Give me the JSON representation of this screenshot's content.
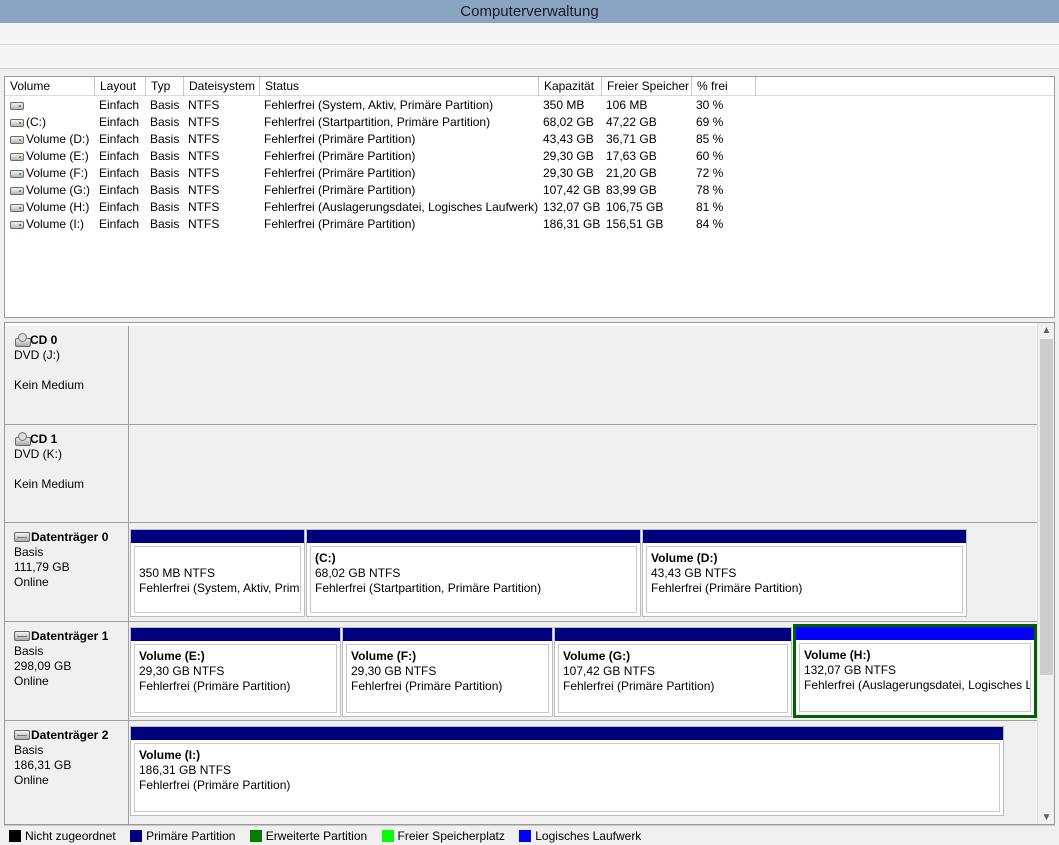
{
  "window": {
    "title": "Computerverwaltung"
  },
  "volume_list": {
    "columns": [
      "Volume",
      "Layout",
      "Typ",
      "Dateisystem",
      "Status",
      "Kapazität",
      "Freier Speicher",
      "% frei"
    ],
    "rows": [
      {
        "volume": "",
        "layout": "Einfach",
        "typ": "Basis",
        "fs": "NTFS",
        "status": "Fehlerfrei (System, Aktiv, Primäre Partition)",
        "kapazitaet": "350 MB",
        "frei": "106 MB",
        "pct": "30 %"
      },
      {
        "volume": "(C:)",
        "layout": "Einfach",
        "typ": "Basis",
        "fs": "NTFS",
        "status": "Fehlerfrei (Startpartition, Primäre Partition)",
        "kapazitaet": "68,02 GB",
        "frei": "47,22 GB",
        "pct": "69 %"
      },
      {
        "volume": "Volume (D:)",
        "layout": "Einfach",
        "typ": "Basis",
        "fs": "NTFS",
        "status": "Fehlerfrei (Primäre Partition)",
        "kapazitaet": "43,43 GB",
        "frei": "36,71 GB",
        "pct": "85 %"
      },
      {
        "volume": "Volume (E:)",
        "layout": "Einfach",
        "typ": "Basis",
        "fs": "NTFS",
        "status": "Fehlerfrei (Primäre Partition)",
        "kapazitaet": "29,30 GB",
        "frei": "17,63 GB",
        "pct": "60 %"
      },
      {
        "volume": "Volume (F:)",
        "layout": "Einfach",
        "typ": "Basis",
        "fs": "NTFS",
        "status": "Fehlerfrei (Primäre Partition)",
        "kapazitaet": "29,30 GB",
        "frei": "21,20 GB",
        "pct": "72 %"
      },
      {
        "volume": "Volume (G:)",
        "layout": "Einfach",
        "typ": "Basis",
        "fs": "NTFS",
        "status": "Fehlerfrei (Primäre Partition)",
        "kapazitaet": "107,42 GB",
        "frei": "83,99 GB",
        "pct": "78 %"
      },
      {
        "volume": "Volume (H:)",
        "layout": "Einfach",
        "typ": "Basis",
        "fs": "NTFS",
        "status": "Fehlerfrei (Auslagerungsdatei, Logisches Laufwerk)",
        "kapazitaet": "132,07 GB",
        "frei": "106,75 GB",
        "pct": "81 %"
      },
      {
        "volume": "Volume (I:)",
        "layout": "Einfach",
        "typ": "Basis",
        "fs": "NTFS",
        "status": "Fehlerfrei (Primäre Partition)",
        "kapazitaet": "186,31 GB",
        "frei": "156,51 GB",
        "pct": "84 %"
      }
    ]
  },
  "disks": {
    "cd0": {
      "name": "CD 0",
      "type": "DVD (J:)",
      "state": "Kein Medium",
      "icon": "cd-drive-icon"
    },
    "cd1": {
      "name": "CD 1",
      "type": "DVD (K:)",
      "state": "Kein Medium",
      "icon": "cd-drive-icon"
    },
    "disk0": {
      "name": "Datenträger 0",
      "type": "Basis",
      "size": "111,79 GB",
      "state": "Online",
      "icon": "hard-disk-icon",
      "partitions": [
        {
          "name": "",
          "size": "350 MB NTFS",
          "status": "Fehlerfrei (System, Aktiv, Primä"
        },
        {
          "name": "(C:)",
          "size": "68,02 GB NTFS",
          "status": "Fehlerfrei (Startpartition, Primäre Partition)"
        },
        {
          "name": "Volume  (D:)",
          "size": "43,43 GB NTFS",
          "status": "Fehlerfrei (Primäre Partition)"
        }
      ]
    },
    "disk1": {
      "name": "Datenträger 1",
      "type": "Basis",
      "size": "298,09 GB",
      "state": "Online",
      "icon": "hard-disk-icon",
      "partitions": [
        {
          "name": "Volume  (E:)",
          "size": "29,30 GB NTFS",
          "status": "Fehlerfrei (Primäre Partition)"
        },
        {
          "name": "Volume  (F:)",
          "size": "29,30 GB NTFS",
          "status": "Fehlerfrei (Primäre Partition)"
        },
        {
          "name": "Volume  (G:)",
          "size": "107,42 GB NTFS",
          "status": "Fehlerfrei (Primäre Partition)"
        },
        {
          "name": "Volume  (H:)",
          "size": "132,07 GB NTFS",
          "status": "Fehlerfrei (Auslagerungsdatei, Logisches L"
        }
      ]
    },
    "disk2": {
      "name": "Datenträger 2",
      "type": "Basis",
      "size": "186,31 GB",
      "state": "Online",
      "icon": "hard-disk-icon",
      "partitions": [
        {
          "name": "Volume  (I:)",
          "size": "186,31 GB NTFS",
          "status": "Fehlerfrei (Primäre Partition)"
        }
      ]
    }
  },
  "legend": [
    {
      "label": "Nicht zugeordnet",
      "color": "#000000"
    },
    {
      "label": "Primäre Partition",
      "color": "#00007f"
    },
    {
      "label": "Erweiterte Partition",
      "color": "#007f00"
    },
    {
      "label": "Freier Speicherplatz",
      "color": "#00ff00"
    },
    {
      "label": "Logisches Laufwerk",
      "color": "#0000ff"
    }
  ],
  "colors": {
    "primary": "#00007f",
    "logical": "#0000ff",
    "selection": "#006000",
    "titlebar": "#8aa5c2"
  }
}
